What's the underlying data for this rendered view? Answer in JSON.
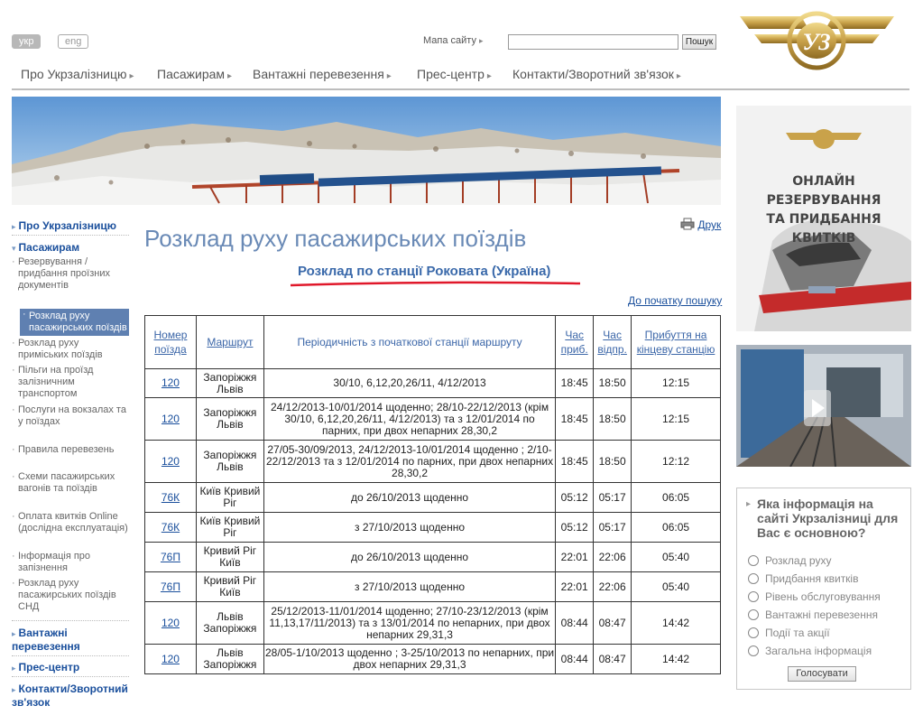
{
  "header": {
    "lang_ukr": "укр",
    "lang_eng": "eng",
    "sitemap": "Мапа сайту",
    "search_button": "Пошук",
    "search_value": ""
  },
  "topnav": [
    "Про Укрзалізницю",
    "Пасажирам",
    "Вантажні перевезення",
    "Прес-центр",
    "Контакти/Зворотний зв'язок"
  ],
  "leftnav": {
    "about": "Про Укрзалізницю",
    "passengers": "Пасажирам",
    "sub": [
      "Резервування / придбання проїзних документів",
      "Розклад руху пасажирських поїздів",
      "Розклад руху приміських поїздів",
      "Пільги на проїзд залізничним транспортом",
      "Послуги на вокзалах та у поїздах",
      "Правила перевезень",
      "Схеми пасажирських вагонів та поїздів",
      "Оплата квитків Online (дослідна експлуатація)",
      "Інформація про запізнення",
      "Розклад руху пасажирських поїздів СНД"
    ],
    "cargo": "Вантажні перевезення",
    "press": "Прес-центр",
    "contacts": "Контакти/Зворотний зв'язок"
  },
  "main": {
    "title": "Розклад руху пасажирських поїздів",
    "print": "Друк",
    "station": "Розклад по станції Роковата (Україна)",
    "to_start": "До початку пошуку",
    "columns": {
      "num": "Номер поїзда",
      "route": "Маршрут",
      "period": "Періодичність з початкової станції маршруту",
      "arr": "Час приб.",
      "dep": "Час відпр.",
      "final": "Прибуття на кінцеву станцію"
    },
    "rows": [
      {
        "num": "120",
        "route": "Запоріжжя Львів",
        "period": "30/10, 6,12,20,26/11, 4/12/2013",
        "arr": "18:45",
        "dep": "18:50",
        "final": "12:15"
      },
      {
        "num": "120",
        "route": "Запоріжжя Львів",
        "period": "24/12/2013-10/01/2014 щоденно; 28/10-22/12/2013 (крім 30/10, 6,12,20,26/11, 4/12/2013) та з 12/01/2014 по парних, при двох непарних 28,30,2",
        "arr": "18:45",
        "dep": "18:50",
        "final": "12:15"
      },
      {
        "num": "120",
        "route": "Запоріжжя Львів",
        "period": "27/05-30/09/2013, 24/12/2013-10/01/2014 щоденно ; 2/10-22/12/2013 та з 12/01/2014 по парних, при двох непарних 28,30,2",
        "arr": "18:45",
        "dep": "18:50",
        "final": "12:12"
      },
      {
        "num": "76К",
        "route": "Київ Кривий Ріг",
        "period": "до 26/10/2013 щоденно",
        "arr": "05:12",
        "dep": "05:17",
        "final": "06:05"
      },
      {
        "num": "76К",
        "route": "Київ Кривий Ріг",
        "period": "з 27/10/2013 щоденно",
        "arr": "05:12",
        "dep": "05:17",
        "final": "06:05"
      },
      {
        "num": "76П",
        "route": "Кривий Ріг Київ",
        "period": "до 26/10/2013 щоденно",
        "arr": "22:01",
        "dep": "22:06",
        "final": "05:40"
      },
      {
        "num": "76П",
        "route": "Кривий Ріг Київ",
        "period": "з 27/10/2013 щоденно",
        "arr": "22:01",
        "dep": "22:06",
        "final": "05:40"
      },
      {
        "num": "120",
        "route": "Львів Запоріжжя",
        "period": "25/12/2013-11/01/2014 щоденно; 27/10-23/12/2013 (крім 11,13,17/11/2013) та з 13/01/2014 по непарних, при двох непарних 29,31,3",
        "arr": "08:44",
        "dep": "08:47",
        "final": "14:42"
      },
      {
        "num": "120",
        "route": "Львів Запоріжжя",
        "period": "28/05-1/10/2013 щоденно ; 3-25/10/2013 по непарних, при двох непарних 29,31,3",
        "arr": "08:44",
        "dep": "08:47",
        "final": "14:42"
      }
    ]
  },
  "right": {
    "ad_line1": "ОНЛАЙН РЕЗЕРВУВАННЯ",
    "ad_line2": "ТА ПРИДБАННЯ КВИТКІВ",
    "logo_text": "УЗ",
    "poll_question": "Яка інформація на сайті Укрзалізниці для Вас є основною?",
    "poll_options": [
      "Розклад руху",
      "Придбання квитків",
      "Рівень обслуговування",
      "Вантажні перевезення",
      "Події та акції",
      "Загальна інформація"
    ],
    "vote": "Голосувати"
  }
}
